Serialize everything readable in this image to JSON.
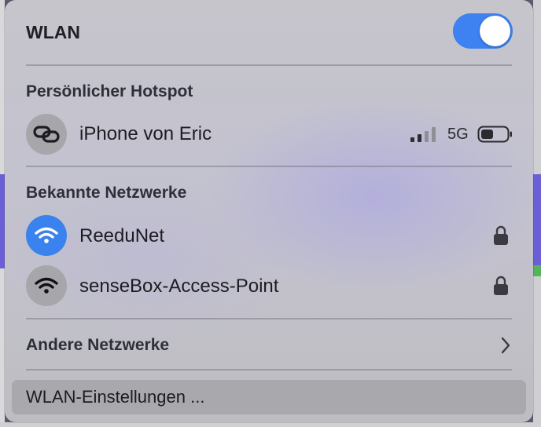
{
  "wlan": {
    "title": "WLAN",
    "enabled": true
  },
  "hotspot": {
    "header": "Persönlicher Hotspot",
    "device_name": "iPhone von Eric",
    "network_type": "5G",
    "signal_bars": 2,
    "battery_level": 0.4
  },
  "known_networks": {
    "header": "Bekannte Netzwerke",
    "items": [
      {
        "name": "ReeduNet",
        "connected": true,
        "secured": true
      },
      {
        "name": "senseBox-Access-Point",
        "connected": false,
        "secured": true
      }
    ]
  },
  "other_networks": {
    "label": "Andere Netzwerke"
  },
  "settings": {
    "label": "WLAN-Einstellungen ..."
  },
  "colors": {
    "accent": "#3d82f0",
    "menu_bg": "#c4c3cb",
    "icon_gray": "#a6a6ab"
  }
}
